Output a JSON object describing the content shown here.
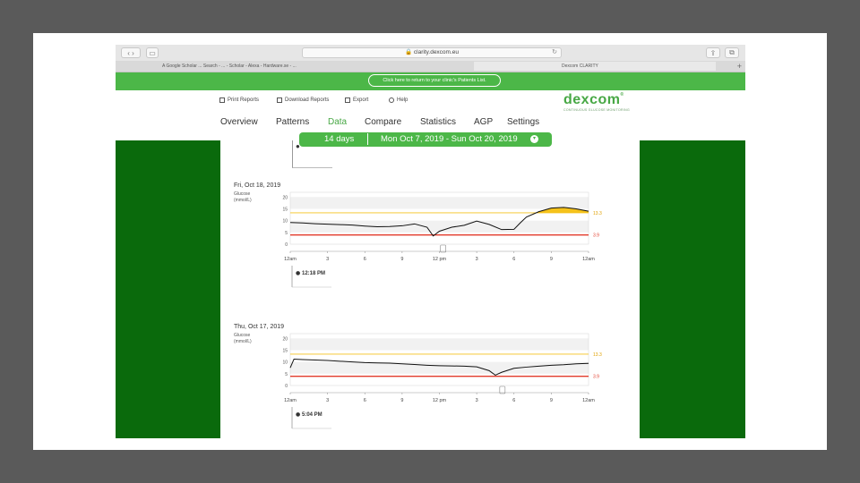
{
  "browser": {
    "url": "clarity.dexcom.eu",
    "tabs": [
      "A Google Scholar ... Search - ... - Scholar - Alexa - Hardware.se - ...",
      "Dexcom CLARITY"
    ]
  },
  "banner": {
    "return_label": "Click here to return to your clinic's Patients List."
  },
  "header": {
    "util": {
      "print": "Print Reports",
      "download": "Download Reports",
      "export": "Export",
      "help": "Help"
    },
    "logo": "dexcom",
    "tagline": "CONTINUOUS GLUCOSE MONITORING",
    "nav": [
      "Overview",
      "Patterns",
      "Data",
      "Compare",
      "Statistics",
      "AGP",
      "Settings"
    ],
    "nav_active": "Data"
  },
  "date_bar": {
    "days": "14 days",
    "range": "Mon Oct 7, 2019 - Sun Oct 20, 2019"
  },
  "prev_fragment": {
    "text": "Re"
  },
  "charts": [
    {
      "date": "Fri, Oct 18, 2019",
      "ylabel1": "Glucose",
      "ylabel2": "(mmol/L)",
      "yticks": [
        "20",
        "15",
        "10",
        "5",
        "0"
      ],
      "xticks": [
        "12am",
        "3",
        "6",
        "9",
        "12 pm",
        "3",
        "6",
        "9",
        "12am"
      ],
      "high_threshold": "13.3",
      "low_threshold": "3.9",
      "event_time": "12:18 PM"
    },
    {
      "date": "Thu, Oct 17, 2019",
      "ylabel1": "Glucose",
      "ylabel2": "(mmol/L)",
      "yticks": [
        "20",
        "15",
        "10",
        "5",
        "0"
      ],
      "xticks": [
        "12am",
        "3",
        "6",
        "9",
        "12 pm",
        "3",
        "6",
        "9",
        "12am"
      ],
      "high_threshold": "13.3",
      "low_threshold": "3.9",
      "event_time": "5:04 PM"
    }
  ],
  "colors": {
    "green": "#4cb748",
    "dark_green": "#0a6a0c",
    "high": "#f5c21b",
    "low": "#e23a2a"
  },
  "chart_data": [
    {
      "type": "line",
      "title": "Fri, Oct 18, 2019",
      "ylabel": "Glucose (mmol/L)",
      "ylim": [
        0,
        22
      ],
      "x": [
        0,
        1,
        2,
        3,
        4,
        5,
        6,
        7,
        8,
        9,
        10,
        11,
        11.5,
        12,
        13,
        14,
        15,
        16,
        17,
        18,
        18.5,
        19,
        20,
        21,
        22,
        23,
        24
      ],
      "series": [
        {
          "values": [
            9.2,
            9.0,
            8.7,
            8.5,
            8.3,
            8.1,
            7.7,
            7.4,
            7.5,
            7.8,
            8.6,
            7.2,
            3.5,
            5.5,
            7.2,
            8.0,
            9.8,
            8.4,
            6.2,
            6.3,
            9.0,
            11.5,
            13.8,
            15.3,
            15.6,
            15.0,
            14.0
          ]
        }
      ],
      "high_threshold": 13.3,
      "low_threshold": 3.9
    },
    {
      "type": "line",
      "title": "Thu, Oct 17, 2019",
      "ylabel": "Glucose (mmol/L)",
      "ylim": [
        0,
        22
      ],
      "x": [
        0,
        0.3,
        1,
        2,
        3,
        4,
        5,
        6,
        7,
        8,
        9,
        10,
        11,
        12,
        13,
        14,
        15,
        16,
        16.5,
        17,
        18,
        19,
        20,
        21,
        22,
        23,
        24
      ],
      "series": [
        {
          "values": [
            7.5,
            11.2,
            11.0,
            10.8,
            10.6,
            10.3,
            10.0,
            9.7,
            9.6,
            9.5,
            9.2,
            8.9,
            8.6,
            8.4,
            8.3,
            8.2,
            7.9,
            6.3,
            4.4,
            5.6,
            7.3,
            7.8,
            8.2,
            8.6,
            8.8,
            9.2,
            9.4
          ]
        }
      ],
      "high_threshold": 13.3,
      "low_threshold": 3.9
    }
  ]
}
